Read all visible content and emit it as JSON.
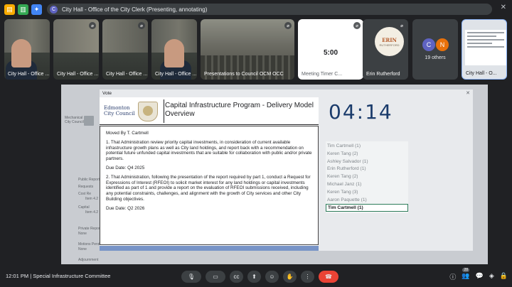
{
  "meeting": {
    "presenting_title": "City Hall - Office of the City Clerk (Presenting, annotating)",
    "presenter_initial": "C",
    "time": "12:01 PM",
    "separator": "|",
    "meeting_name": "Special Infrastructure Committee"
  },
  "tiles": [
    {
      "label": "City Hall - Office ..."
    },
    {
      "label": "City Hall - Office ..."
    },
    {
      "label": "City Hall - Office ..."
    },
    {
      "label": "City Hall - Office ..."
    },
    {
      "label": "Presentations to Council OCM OCC"
    },
    {
      "label": "Meeting Timer C...",
      "timer": "5:00"
    },
    {
      "label": "Erin Rutherford",
      "avatar_text": "ERIN",
      "avatar_sub": "RUTHERFORD"
    },
    {
      "label": "19 others",
      "initials": [
        "C",
        "N"
      ]
    },
    {
      "label": "City Hall - O..."
    }
  ],
  "vote": {
    "window_title": "Vote",
    "logo_text": [
      "Edmonton",
      "City Council"
    ],
    "motion_title": "Capital Infrastructure Program - Delivery Model Overview",
    "paragraphs": [
      "Moved By T. Cartmell",
      "1. That Administration review priority capital investments, in consideration of current available infrastructure growth plans as well as City land holdings, and report back with a recommendation on potential future unfunded capital investments that are suitable for collaboration with public and/or private partners.",
      "Due Date: Q4 2025",
      "2. That Administration, following the presentation of the report required by part 1, conduct a Request for Expressions of Interest (RFEOI) to solicit market interest for any land holdings or capital investments identified as part of 1 and provide a report on the evaluation of RFEOI submissions received, including any potential constraints, challenges, and alignment with the growth of City services and other City Building objectives.",
      "Due Date: Q2 2026"
    ],
    "clock": "04:14",
    "speakers": [
      "Tim Cartmell (1)",
      "Keren Tang (2)",
      "Ashley Salvador (1)",
      "Erin Rutherford (1)",
      "Keren Tang (2)",
      "Michael Janz (1)",
      "Keren Tang (3)",
      "Aaron Paquette (1)",
      "Tim Cartmell (1)"
    ]
  },
  "background_doc": {
    "header_lines": [
      "Mechanical",
      "City Council"
    ],
    "items": [
      "Public Report",
      "Requests",
      "Cost Re",
      "Item 4.2",
      "Capital",
      "Item 4.2",
      "Private Report",
      "None",
      "Motions Pending",
      "None",
      "Adjournment"
    ]
  },
  "people_count": "28",
  "colors": {
    "accent_blue": "#8ab4f8",
    "hangup_red": "#ea4335",
    "clock_blue": "#1a3b6b",
    "active_outline": "#2e7d5b"
  }
}
